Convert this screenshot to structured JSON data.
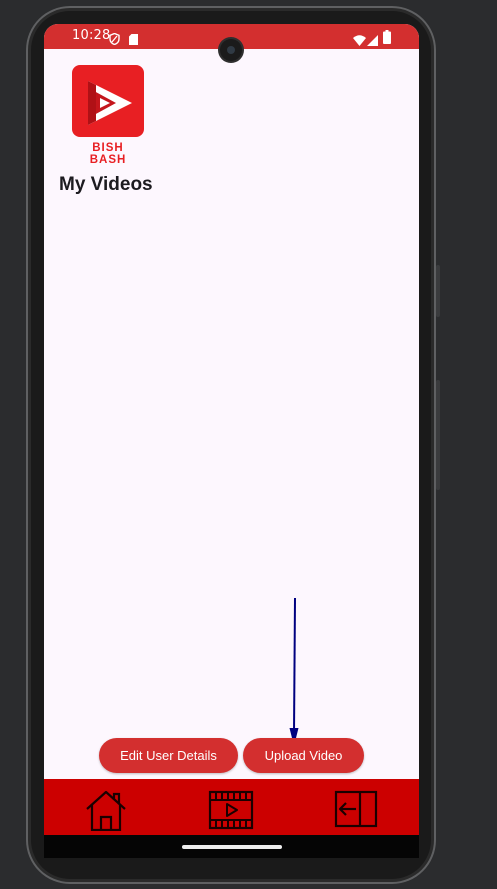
{
  "status_bar": {
    "time": "10:28",
    "icons": [
      "shield-icon",
      "sd-card-icon",
      "wifi-icon",
      "signal-icon",
      "battery-icon"
    ]
  },
  "app": {
    "logo_text": "BISH BASH",
    "page_title": "My Videos"
  },
  "actions": {
    "edit_user_details": "Edit User Details",
    "upload_video": "Upload Video"
  },
  "bottom_nav": {
    "items": [
      {
        "icon": "home-icon"
      },
      {
        "icon": "video-film-icon"
      },
      {
        "icon": "logout-icon"
      }
    ]
  },
  "colors": {
    "primary": "#d32f2f",
    "nav_bar": "#cc0000",
    "background": "#fdf7fe",
    "logo": "#e81f23",
    "annotation_arrow": "#000080"
  }
}
